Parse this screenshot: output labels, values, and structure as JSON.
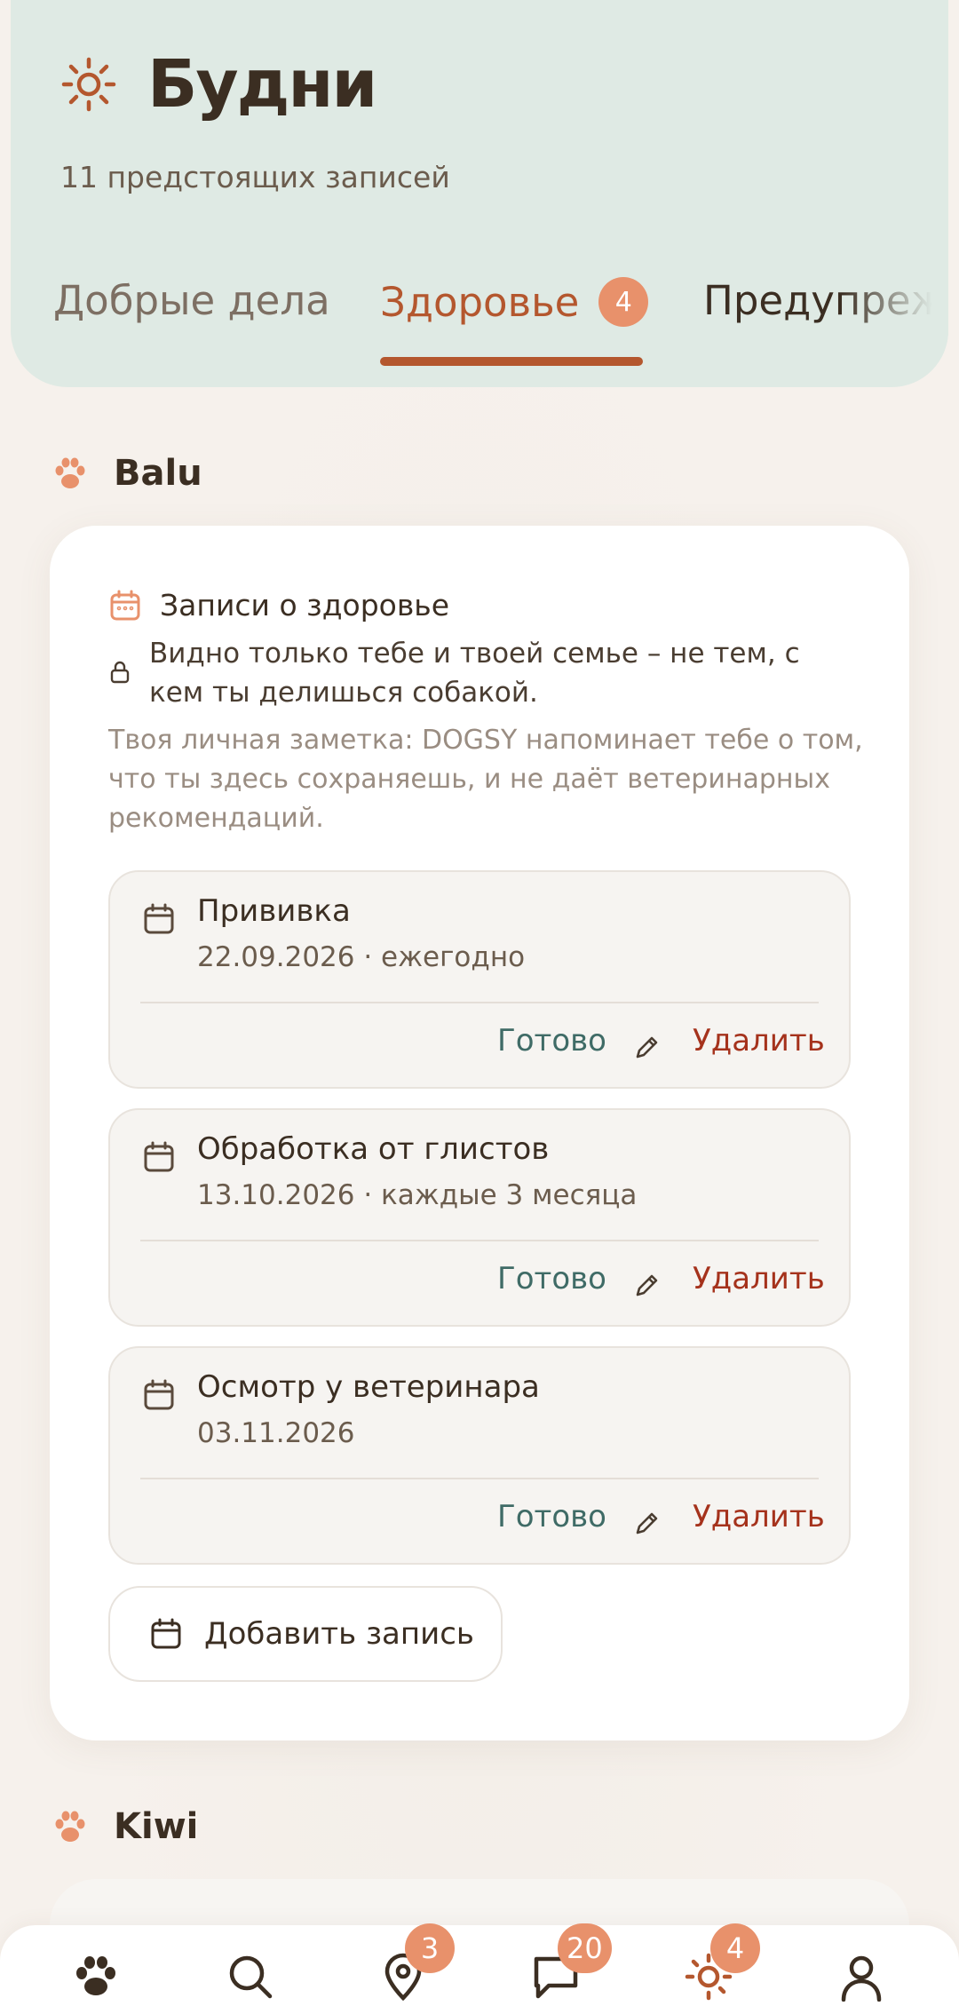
{
  "header": {
    "title": "Будни",
    "subtitle": "11 предстоящих записей"
  },
  "tabs": [
    {
      "label": "Добрые дела"
    },
    {
      "label": "Здоровье",
      "badge": "4",
      "active": true
    },
    {
      "label": "Предупреждения"
    }
  ],
  "sections": [
    {
      "dog_name": "Balu",
      "card": {
        "title": "Записи о здоровье",
        "privacy": "Видно только тебе и твоей семье – не тем, с кем ты делишься собакой.",
        "note": "Твоя личная заметка: DOGSY напоминает тебе о том, что ты здесь сохраняешь, и не даёт ветеринарных рекомендаций.",
        "entries": [
          {
            "title": "Прививка",
            "subtitle": "22.09.2026 · ежегодно",
            "done_label": "Готово",
            "delete_label": "Удалить"
          },
          {
            "title": "Обработка от глистов",
            "subtitle": "13.10.2026 · каждые 3 месяца",
            "done_label": "Готово",
            "delete_label": "Удалить"
          },
          {
            "title": "Осмотр у ветеринара",
            "subtitle": "03.11.2026",
            "done_label": "Готово",
            "delete_label": "Удалить"
          }
        ],
        "add_label": "Добавить запись"
      }
    },
    {
      "dog_name": "Kiwi"
    }
  ],
  "bottom_nav": [
    {
      "icon": "paw-icon"
    },
    {
      "icon": "search-icon"
    },
    {
      "icon": "map-pin-icon",
      "badge": "3"
    },
    {
      "icon": "chat-icon",
      "badge": "20"
    },
    {
      "icon": "sun-icon",
      "badge": "4",
      "active": true
    },
    {
      "icon": "profile-icon"
    }
  ],
  "colors": {
    "accent": "#b4572e",
    "badge": "#e8916b",
    "header_bg": "#dfeae4",
    "done": "#3f6b66",
    "delete": "#a5321c"
  }
}
